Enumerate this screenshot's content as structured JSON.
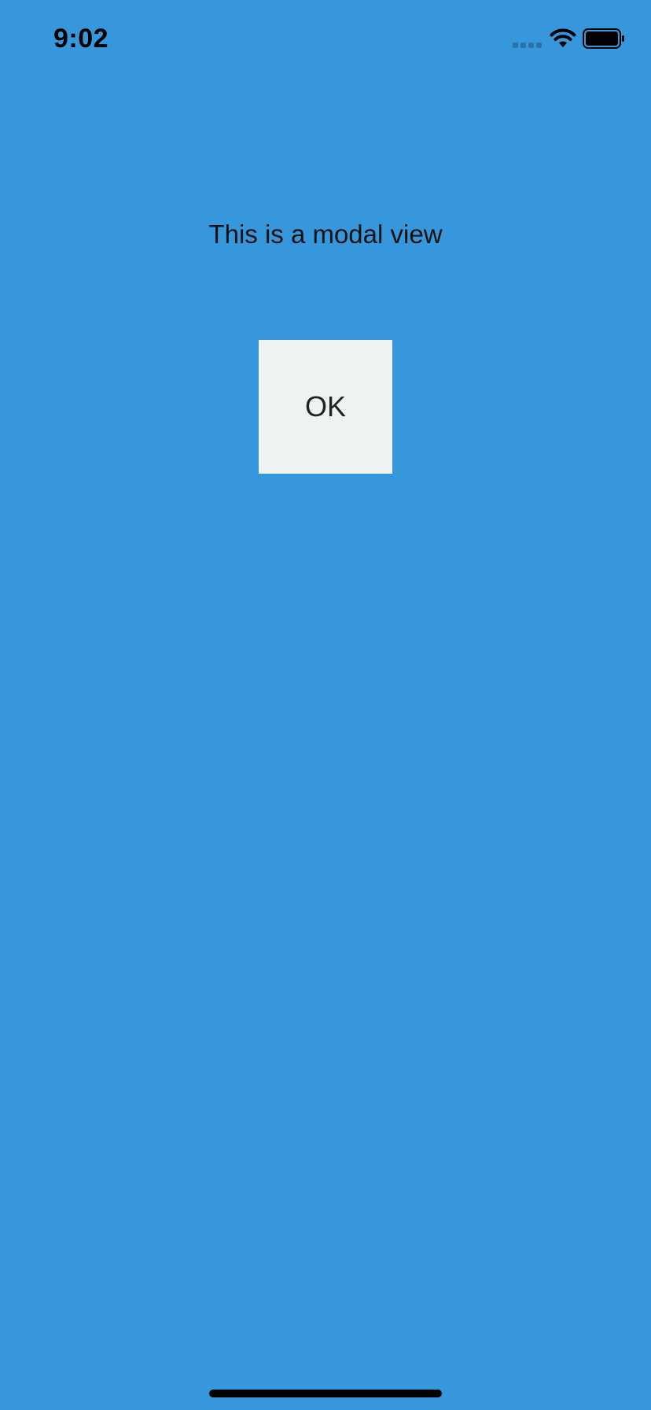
{
  "status_bar": {
    "time": "9:02",
    "icons": [
      "cellular-signal-icon",
      "wifi-icon",
      "battery-icon"
    ]
  },
  "modal": {
    "message": "This is a modal view",
    "ok_label": "OK"
  },
  "colors": {
    "background": "#3797dc",
    "button_background": "#eef2f3",
    "text": "#111111"
  }
}
